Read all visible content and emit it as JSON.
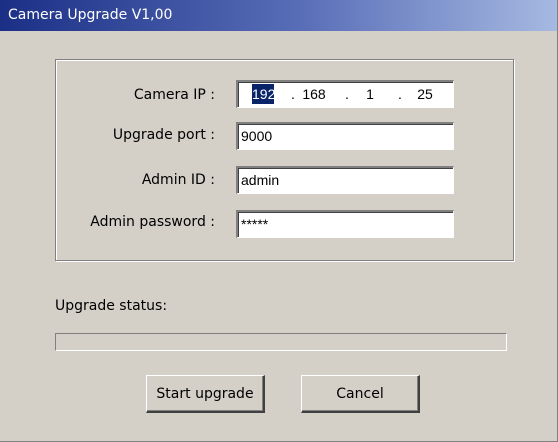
{
  "window": {
    "title": "Camera Upgrade V1,00"
  },
  "form": {
    "camera_ip_label": "Camera IP :",
    "camera_ip": {
      "octets": [
        "192",
        "168",
        "1",
        "25"
      ],
      "separator": ".",
      "selected_octet": 0
    },
    "upgrade_port_label": "Upgrade port :",
    "upgrade_port_value": "9000",
    "admin_id_label": "Admin ID :",
    "admin_id_value": "admin",
    "admin_password_label": "Admin password :",
    "admin_password_value": "*****"
  },
  "status": {
    "label": "Upgrade status:",
    "progress": 0
  },
  "buttons": {
    "start_label": "Start upgrade",
    "cancel_label": "Cancel"
  },
  "colors": {
    "titlebar_start": "#1b2f86",
    "titlebar_end": "#a6b9e2",
    "window_bg": "#d4d0c8",
    "selection": "#0a246a"
  }
}
